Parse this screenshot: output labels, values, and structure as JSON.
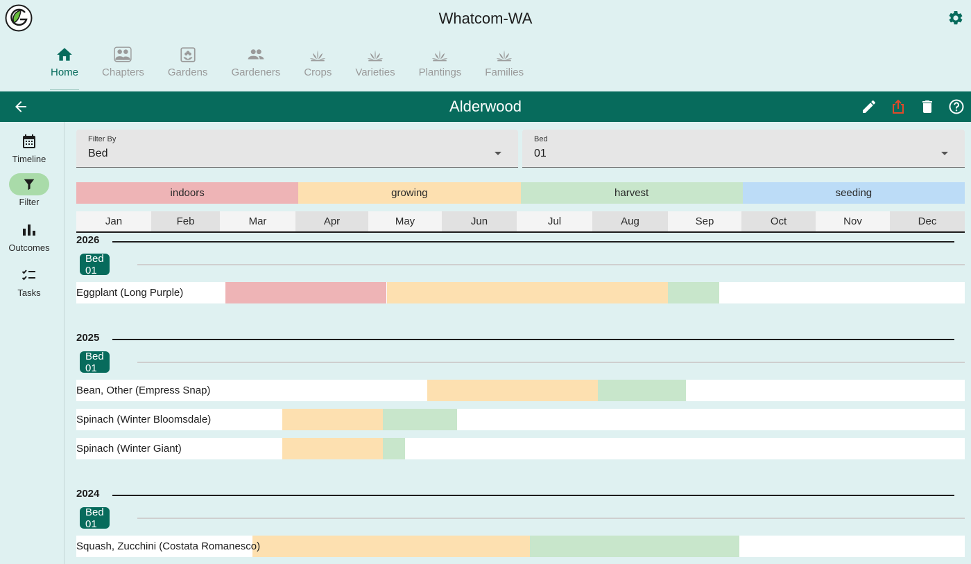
{
  "app": {
    "title": "Whatcom-WA"
  },
  "nav": [
    {
      "label": "Home",
      "icon": "home-icon",
      "active": true
    },
    {
      "label": "Chapters",
      "icon": "chapters-icon"
    },
    {
      "label": "Gardens",
      "icon": "gardens-icon"
    },
    {
      "label": "Gardeners",
      "icon": "gardeners-icon"
    },
    {
      "label": "Crops",
      "icon": "crops-icon"
    },
    {
      "label": "Varieties",
      "icon": "varieties-icon"
    },
    {
      "label": "Plantings",
      "icon": "plantings-icon"
    },
    {
      "label": "Families",
      "icon": "families-icon"
    }
  ],
  "titlebar": {
    "title": "Alderwood"
  },
  "rail": [
    {
      "label": "Timeline",
      "icon": "calendar-icon"
    },
    {
      "label": "Filter",
      "icon": "filter-icon",
      "active": true
    },
    {
      "label": "Outcomes",
      "icon": "bar-chart-icon"
    },
    {
      "label": "Tasks",
      "icon": "checklist-icon"
    }
  ],
  "filters": {
    "filter_by": {
      "label": "Filter By",
      "value": "Bed"
    },
    "bed": {
      "label": "Bed",
      "value": "01"
    }
  },
  "legend": [
    {
      "label": "indoors",
      "color": "#eeb4b6"
    },
    {
      "label": "growing",
      "color": "#fde0b0"
    },
    {
      "label": "harvest",
      "color": "#c8e6cb"
    },
    {
      "label": "seeding",
      "color": "#bcdcf7"
    }
  ],
  "months": [
    "Jan",
    "Feb",
    "Mar",
    "Apr",
    "May",
    "Jun",
    "Jul",
    "Aug",
    "Sep",
    "Oct",
    "Nov",
    "Dec"
  ],
  "colors": {
    "primary": "#076b5c",
    "background": "#dff1f1",
    "share_icon": "#e04a2a",
    "month_alt_bg": "#e1e1e1",
    "month_bg": "#f4f4f4"
  },
  "timeline": [
    {
      "year": "2026",
      "beds": [
        {
          "name": "Bed 01",
          "plantings": [
            {
              "name": "Eggplant (Long Purple)",
              "segments": [
                {
                  "phase": "indoors",
                  "start": 2.07,
                  "end": 4.25
                },
                {
                  "phase": "growing",
                  "start": 4.25,
                  "end": 8.0
                },
                {
                  "phase": "harvest",
                  "start": 8.0,
                  "end": 8.7
                }
              ]
            }
          ]
        }
      ]
    },
    {
      "year": "2025",
      "beds": [
        {
          "name": "Bed 01",
          "plantings": [
            {
              "name": "Bean, Other (Empress Snap)",
              "segments": [
                {
                  "phase": "growing",
                  "start": 4.8,
                  "end": 7.07
                },
                {
                  "phase": "harvest",
                  "start": 7.07,
                  "end": 8.25
                }
              ]
            },
            {
              "name": "Spinach (Winter Bloomsdale)",
              "segments": [
                {
                  "phase": "growing",
                  "start": 2.83,
                  "end": 4.2
                },
                {
                  "phase": "harvest",
                  "start": 4.2,
                  "end": 5.2
                }
              ]
            },
            {
              "name": "Spinach (Winter Giant)",
              "segments": [
                {
                  "phase": "growing",
                  "start": 2.83,
                  "end": 4.2
                },
                {
                  "phase": "harvest",
                  "start": 4.2,
                  "end": 4.5
                }
              ]
            }
          ]
        }
      ]
    },
    {
      "year": "2024",
      "beds": [
        {
          "name": "Bed 01",
          "plantings": [
            {
              "name": "Squash, Zucchini (Costata Romanesco)",
              "segments": [
                {
                  "phase": "growing",
                  "start": 2.43,
                  "end": 6.17
                },
                {
                  "phase": "harvest",
                  "start": 6.17,
                  "end": 8.97
                }
              ]
            }
          ]
        }
      ]
    }
  ]
}
